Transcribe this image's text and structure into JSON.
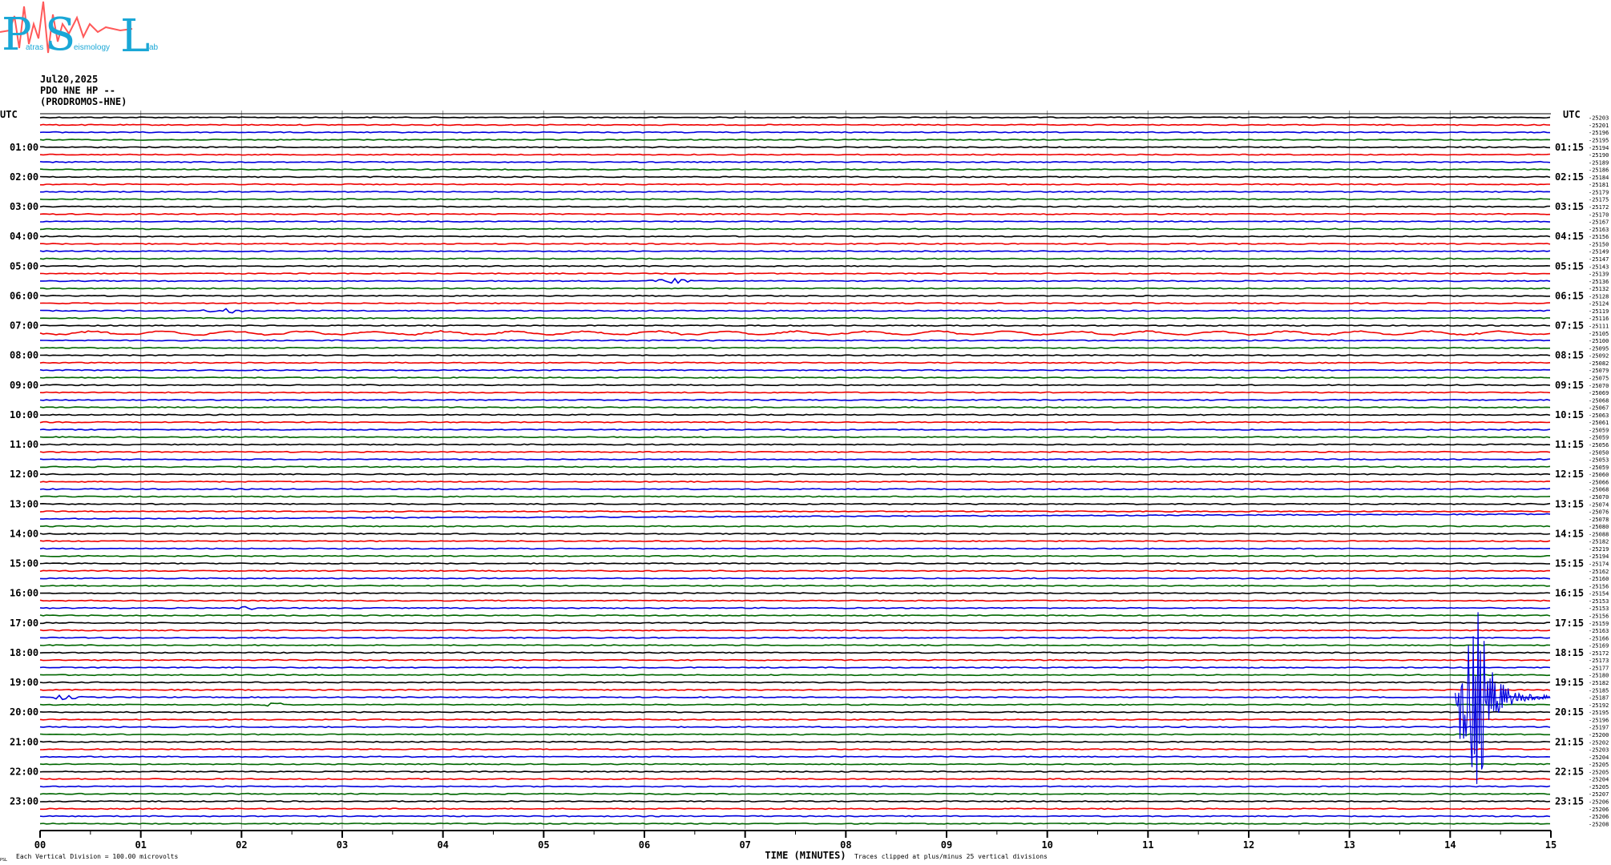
{
  "logo": {
    "big_letters": [
      "P",
      "S",
      "L"
    ],
    "small_text": [
      "atras",
      "eismology",
      "ab"
    ]
  },
  "header": {
    "date": "Jul20,2025",
    "channel": "PDO HNE HP --",
    "station": "(PRODROMOS-HNE)"
  },
  "chart_data": {
    "type": "line",
    "subtype": "helicorder",
    "trace_colors": [
      "#000000",
      "#ee0000",
      "#0000dd",
      "#006600"
    ],
    "left_axis_title": "UTC",
    "right_axis_title": "UTC",
    "left_time_labels": [
      "01:00",
      "02:00",
      "03:00",
      "04:00",
      "05:00",
      "06:00",
      "07:00",
      "08:00",
      "09:00",
      "10:00",
      "11:00",
      "12:00",
      "13:00",
      "14:00",
      "15:00",
      "16:00",
      "17:00",
      "18:00",
      "19:00",
      "20:00",
      "21:00",
      "22:00",
      "23:00"
    ],
    "right_time_labels": [
      "01:15",
      "02:15",
      "03:15",
      "04:15",
      "05:15",
      "06:15",
      "07:15",
      "08:15",
      "09:15",
      "10:15",
      "11:15",
      "12:15",
      "13:15",
      "14:15",
      "15:15",
      "16:15",
      "17:15",
      "18:15",
      "19:15",
      "20:15",
      "21:15",
      "22:15",
      "23:15"
    ],
    "x_ticks": [
      "00",
      "01",
      "02",
      "03",
      "04",
      "05",
      "06",
      "07",
      "08",
      "09",
      "10",
      "11",
      "12",
      "13",
      "14",
      "15"
    ],
    "xlabel": "TIME (MINUTES)",
    "xlim": [
      0,
      15
    ],
    "traces_per_hour": 4,
    "trace_count": 96,
    "trace_offsets": [
      -25203,
      -25201,
      -25196,
      -25195,
      -25194,
      -25190,
      -25189,
      -25186,
      -25184,
      -25181,
      -25179,
      -25175,
      -25172,
      -25170,
      -25167,
      -25163,
      -25156,
      -25150,
      -25149,
      -25147,
      -25143,
      -25139,
      -25136,
      -25132,
      -25128,
      -25124,
      -25119,
      -25116,
      -25111,
      -25105,
      -25100,
      -25095,
      -25092,
      -25082,
      -25079,
      -25075,
      -25070,
      -25069,
      -25068,
      -25067,
      -25063,
      -25061,
      -25059,
      -25059,
      -25056,
      -25050,
      -25053,
      -25059,
      -25060,
      -25066,
      -25068,
      -25070,
      -25074,
      -25076,
      -25078,
      -25080,
      -25088,
      -25182,
      -25219,
      -25194,
      -25174,
      -25162,
      -25160,
      -25156,
      -25154,
      -25153,
      -25153,
      -25156,
      -25159,
      -25163,
      -25166,
      -25169,
      -25172,
      -25173,
      -25177,
      -25180,
      -25182,
      -25185,
      -25187,
      -25192,
      -25195,
      -25196,
      -25197,
      -25200,
      -25202,
      -25203,
      -25204,
      -25205,
      -25205,
      -25204,
      -25205,
      -25207,
      -25206,
      -25206,
      -25206,
      -25208
    ],
    "events": [
      {
        "trace": 22,
        "start_min": 6.0,
        "end_min": 6.6,
        "amp": 4
      },
      {
        "trace": 26,
        "start_min": 1.5,
        "end_min": 2.3,
        "amp": 3
      },
      {
        "trace": 29,
        "start_min": 0.0,
        "end_min": 15.0,
        "amp": 3,
        "type": "swell"
      },
      {
        "trace": 54,
        "start_min": 0.0,
        "end_min": 15.0,
        "amp": 2,
        "type": "drift"
      },
      {
        "trace": 66,
        "start_min": 1.9,
        "end_min": 2.2,
        "amp": 3
      },
      {
        "trace": 78,
        "start_min": 0.0,
        "end_min": 0.45,
        "amp": 3
      },
      {
        "trace": 79,
        "start_min": 2.15,
        "end_min": 2.5,
        "amp": 3
      },
      {
        "trace": 78,
        "start_min": 14.05,
        "end_min": 15.0,
        "amp": 120,
        "type": "quake"
      }
    ],
    "footer_left": "Each Vertical Division =  100.00 microvolts",
    "footer_right": "Traces clipped at plus/minus 25 vertical divisions",
    "corner_mark": "PSL"
  }
}
